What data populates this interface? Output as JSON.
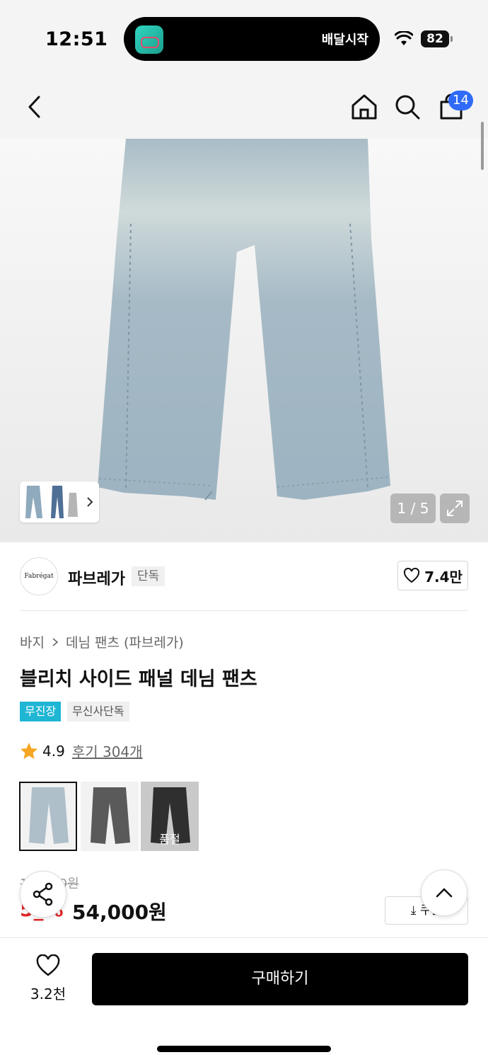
{
  "status_bar": {
    "time": "12:51",
    "live_activity_text": "배달시작",
    "battery": "82"
  },
  "nav": {
    "back_icon": "chevron-left-icon",
    "home_icon": "home-icon",
    "search_icon": "search-icon",
    "cart_icon": "shopping-bag-icon",
    "cart_count": "14"
  },
  "gallery": {
    "counter": "1 / 5",
    "expand_icon": "expand-icon"
  },
  "brand": {
    "logo_text": "Fabrégat",
    "name": "파브레가",
    "tag": "단독",
    "like_count": "7.4만"
  },
  "product": {
    "breadcrumb": [
      "바지",
      "데님 팬츠 (파브레가)"
    ],
    "title": "블리치 사이드 패널 데님 팬츠",
    "badges": [
      "무진장",
      "무신사단독"
    ],
    "rating": "4.9",
    "review_link": "후기 304개",
    "colors": [
      {
        "name": "light-blue",
        "color": "#aebfca",
        "sold_out": ""
      },
      {
        "name": "gray",
        "color": "#5a5a5a",
        "sold_out": ""
      },
      {
        "name": "black",
        "color": "#2f2f2f",
        "sold_out": "품절"
      }
    ],
    "original_price": "1__,_00원",
    "discount": "5_%",
    "sale_price": "54,000원",
    "coupon": "쿠폰"
  },
  "bottom": {
    "wish_count": "3.2천",
    "buy_label": "구매하기"
  },
  "colors": {
    "accent_blue": "#2f6bf6",
    "badge_cyan": "#1fb6d4",
    "discount_red": "#e3282a",
    "star_orange": "#f5a623"
  }
}
